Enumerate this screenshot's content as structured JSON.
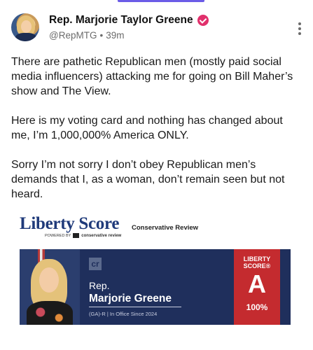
{
  "post": {
    "display_name": "Rep. Marjorie Taylor Greene",
    "handle": "@RepMTG",
    "separator": "•",
    "time": "39m",
    "paragraphs": [
      "There are pathetic Republican men (mostly paid social media influencers) attacking me for going on Bill Maher’s show and The View.",
      "Here is my voting card and nothing has changed about me, I’m 1,000,000% America ONLY.",
      "Sorry I’m not sorry I don’t obey Republican men’s demands that I, as a woman, don’t remain seen but not heard."
    ],
    "icons": {
      "avatar": "profile-photo",
      "verified": "verified-badge-icon",
      "more": "more-vertical-icon"
    },
    "colors": {
      "verified": "#e1306c",
      "accent": "#6b5ce7"
    }
  },
  "scorecard": {
    "logo": "Liberty Score",
    "powered_by": "POWERED BY",
    "powered_by_brand": "conservative review",
    "publisher": "Conservative Review",
    "cr_mark": "cr",
    "rep_label": "Rep.",
    "rep_name": "Marjorie Greene",
    "rep_meta": "(GA)-R  | In Office Since 2024",
    "ribbon_brand_line1": "LIBERTY",
    "ribbon_brand_line2": "SCORE®",
    "grade": "A",
    "score": "100%",
    "colors": {
      "card_bg": "#1f2f5c",
      "ribbon": "#c42b2f",
      "logo": "#1f3a7a"
    }
  }
}
